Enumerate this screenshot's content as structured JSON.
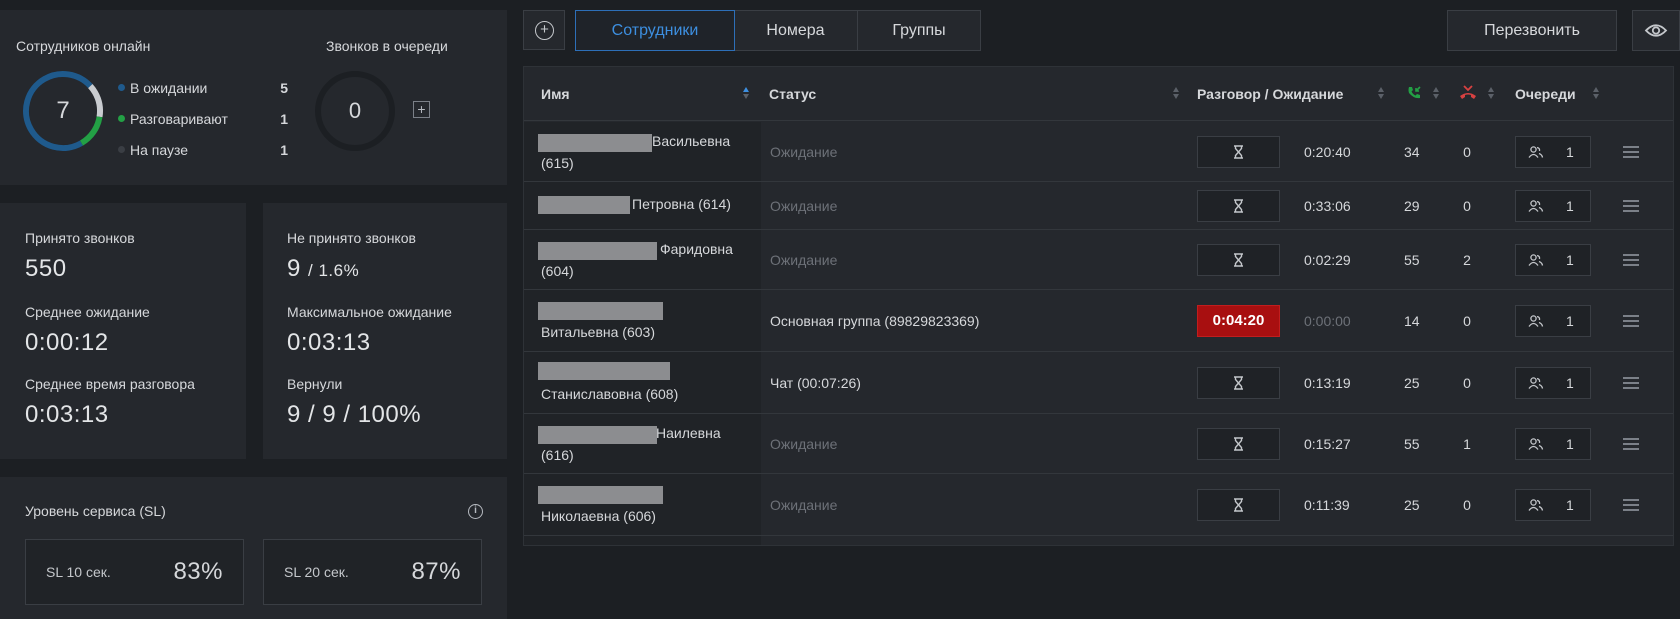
{
  "online": {
    "title": "Сотрудников онлайн",
    "total": "7",
    "legend": [
      {
        "label": "В ожидании",
        "value": "5",
        "color": "#1f5a8c"
      },
      {
        "label": "Разговаривают",
        "value": "1",
        "color": "#23a045"
      },
      {
        "label": "На паузе",
        "value": "1",
        "color": "#3a3e44"
      }
    ],
    "ring": {
      "waiting": 5,
      "talking": 1,
      "paused": 1,
      "colors": {
        "waiting": "#1f5a8c",
        "talking": "#23a045",
        "paused": "#c9ccd0"
      }
    }
  },
  "queue": {
    "title": "Звонков в очереди",
    "count": "0",
    "plus": "+"
  },
  "stats": {
    "accepted_label": "Принято звонков",
    "accepted_value": "550",
    "missed_label": "Не принято звонков",
    "missed_value": "9",
    "missed_pct": "/ 1.6%",
    "avg_wait_label": "Среднее ожидание",
    "avg_wait_value": "0:00:12",
    "max_wait_label": "Максимальное ожидание",
    "max_wait_value": "0:03:13",
    "avg_talk_label": "Среднее время разговора",
    "avg_talk_value": "0:03:13",
    "returned_label": "Вернули",
    "returned_value": "9 / 9 / 100%"
  },
  "sl": {
    "title": "Уровень сервиса (SL)",
    "info": "i",
    "boxes": [
      {
        "label": "SL 10 сек.",
        "value": "83%"
      },
      {
        "label": "SL 20 сек.",
        "value": "87%"
      }
    ]
  },
  "toolbar": {
    "tabs": [
      "Сотрудники",
      "Номера",
      "Группы"
    ],
    "active_tab": 0,
    "callback_label": "Перезвонить",
    "accent": "#3d8fe0"
  },
  "table": {
    "headers": {
      "name": "Имя",
      "status": "Статус",
      "talk_wait": "Разговор / Ожидание",
      "queues": "Очереди"
    },
    "icons": {
      "accepted": "phone-incoming-icon",
      "missed": "phone-missed-icon",
      "accepted_color": "#23a045",
      "missed_color": "#d84141"
    },
    "rows": [
      {
        "name1": "Васильевна",
        "name2": "(615)",
        "status": "Ожидание",
        "status_active": false,
        "timer": "",
        "wait": "0:20:40",
        "accepted": "34",
        "missed": "0",
        "queues": "1"
      },
      {
        "name1": "Петровна (614)",
        "name2": "",
        "status": "Ожидание",
        "status_active": false,
        "timer": "",
        "wait": "0:33:06",
        "accepted": "29",
        "missed": "0",
        "queues": "1"
      },
      {
        "name1": "Фаридовна",
        "name2": "(604)",
        "status": "Ожидание",
        "status_active": false,
        "timer": "",
        "wait": "0:02:29",
        "accepted": "55",
        "missed": "2",
        "queues": "1"
      },
      {
        "name1": "",
        "name2": "Витальевна (603)",
        "status": "Основная группа (89829823369)",
        "status_active": true,
        "timer": "0:04:20",
        "wait": "0:00:00",
        "accepted": "14",
        "missed": "0",
        "queues": "1"
      },
      {
        "name1": "",
        "name2": "Станиславовна (608)",
        "status": "Чат (00:07:26)",
        "status_active": true,
        "timer": "",
        "wait": "0:13:19",
        "accepted": "25",
        "missed": "0",
        "queues": "1"
      },
      {
        "name1": "Наилевна",
        "name2": "(616)",
        "status": "Ожидание",
        "status_active": false,
        "timer": "",
        "wait": "0:15:27",
        "accepted": "55",
        "missed": "1",
        "queues": "1"
      },
      {
        "name1": "",
        "name2": "Николаевна (606)",
        "status": "Ожидание",
        "status_active": false,
        "timer": "",
        "wait": "0:11:39",
        "accepted": "25",
        "missed": "0",
        "queues": "1"
      }
    ]
  }
}
